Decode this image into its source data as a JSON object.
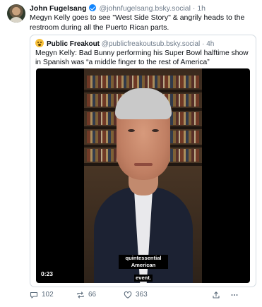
{
  "post": {
    "author_name": "John Fugelsang",
    "handle": "@johnfugelsang.bsky.social",
    "separator": "·",
    "time": "1h",
    "text": "Megyn Kelly goes to see \"West Side Story\" & angrily heads to the restroom during all the Puerto Rican parts."
  },
  "quote": {
    "author_name": "Public Freakout",
    "handle": "@publicfreakoutsub.bsky.social",
    "separator": "·",
    "time": "4h",
    "text": "Megyn Kelly: Bad Bunny performing his Super Bowl halftime show in Spanish was “a middle finger to the rest of America”",
    "video": {
      "caption_line1": "quintessential American",
      "caption_line2": "event.",
      "duration": "0:23"
    }
  },
  "actions": {
    "replies": "102",
    "reposts": "66",
    "likes": "363"
  },
  "icons": {
    "verified": "verified-badge-icon",
    "reply": "reply-icon",
    "repost": "repost-icon",
    "like": "heart-icon",
    "share": "share-icon",
    "more": "more-icon"
  },
  "colors": {
    "verified": "#1185fe",
    "muted": "#6f7c8b",
    "border": "#d4dbe2"
  }
}
